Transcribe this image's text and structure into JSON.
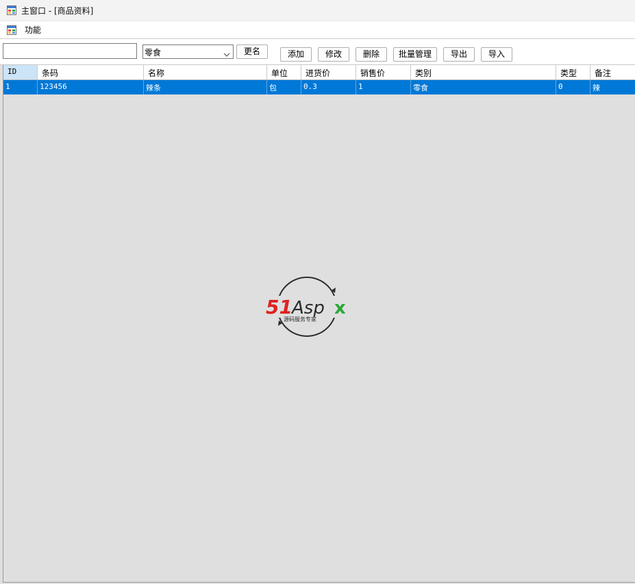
{
  "window": {
    "title": "主窗口 - [商品资料]"
  },
  "menu": {
    "items": [
      {
        "label": "功能"
      }
    ]
  },
  "toolbar": {
    "search_value": "",
    "category_selected": "零食",
    "rename_label": "更名",
    "add_label": "添加",
    "edit_label": "修改",
    "delete_label": "删除",
    "batch_label": "批量管理",
    "export_label": "导出",
    "import_label": "导入"
  },
  "grid": {
    "columns": [
      "ID",
      "条码",
      "名称",
      "单位",
      "进货价",
      "销售价",
      "类别",
      "类型",
      "备注"
    ],
    "rows": [
      [
        "1",
        "123456",
        "辣条",
        "包",
        "0.3",
        "1",
        "零食",
        "0",
        "辣"
      ]
    ]
  },
  "watermark": {
    "brand": "51Aspx",
    "tagline": "源码服务专家"
  },
  "colors": {
    "selection": "#0078d7",
    "logo_red": "#e02020",
    "logo_green": "#2aa839"
  }
}
